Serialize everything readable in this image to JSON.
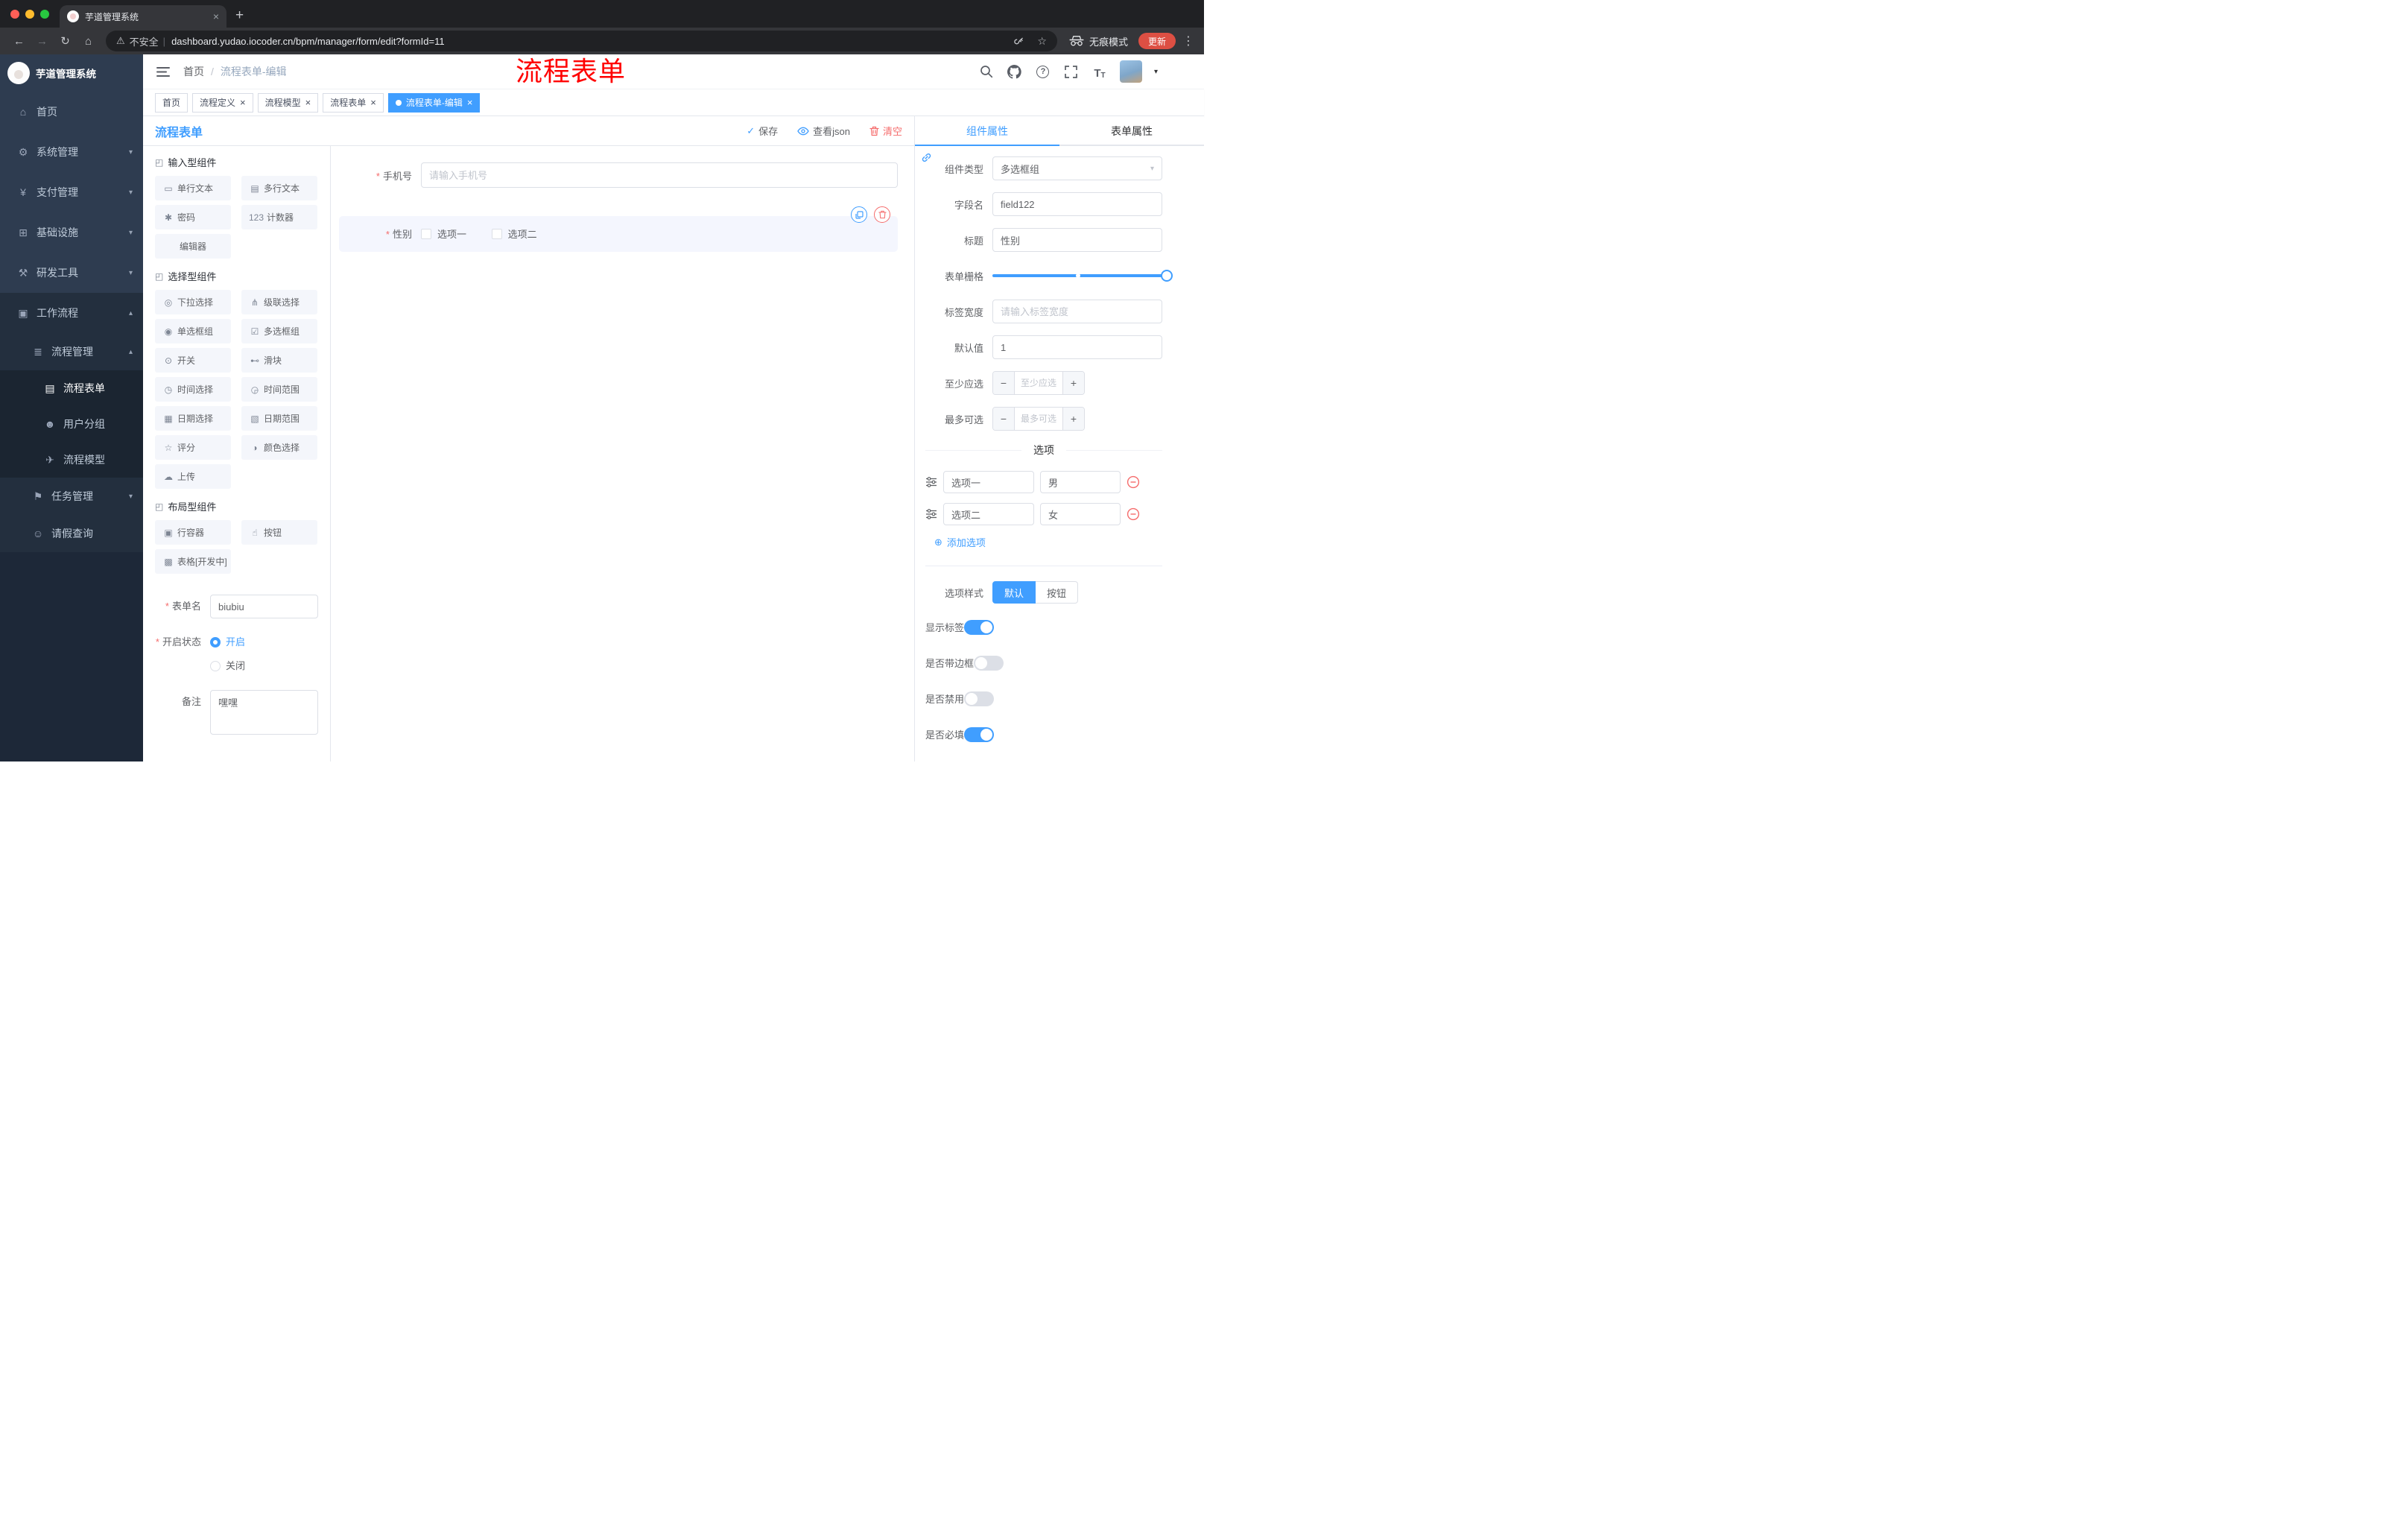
{
  "colors": {
    "accent": "#409eff",
    "danger": "#f56c6c",
    "annotation_text": "#ff0000",
    "update_button": "#dd4f43",
    "sidebar_bg": "#1d2838",
    "active_tag_bg": "#409eff"
  },
  "glyphs": {
    "back": "←",
    "forward": "→",
    "reload": "↻",
    "home": "⌂",
    "plus": "+",
    "close": "×",
    "warning": "⚠",
    "divider": "|",
    "star": "☆",
    "kebab": "⋮",
    "slash": "/",
    "check": "✓",
    "caret_down": "▾",
    "question": "?",
    "font_large": "T",
    "font_small": "T",
    "minus": "−",
    "add_circle": "⊕"
  },
  "browser": {
    "tab_title": "芋道管理系统",
    "security_label": "不安全",
    "url": "dashboard.yudao.iocoder.cn/bpm/manager/form/edit?formId=11",
    "incognito_label": "无痕模式",
    "update_label": "更新"
  },
  "sidebar": {
    "logo_title": "芋道管理系统",
    "items": [
      {
        "label": "首页",
        "glyph": "⌂",
        "icon_name": "dashboard-icon",
        "chevron": ""
      },
      {
        "label": "系统管理",
        "glyph": "⚙",
        "icon_name": "gear-icon",
        "chevron": "▾"
      },
      {
        "label": "支付管理",
        "glyph": "¥",
        "icon_name": "payment-icon",
        "chevron": "▾"
      },
      {
        "label": "基础设施",
        "glyph": "⊞",
        "icon_name": "infrastructure-icon",
        "chevron": "▾"
      },
      {
        "label": "研发工具",
        "glyph": "⚒",
        "icon_name": "devtools-icon",
        "chevron": "▾"
      },
      {
        "label": "工作流程",
        "glyph": "▣",
        "icon_name": "workflow-icon",
        "chevron": "▴",
        "open": true
      },
      {
        "label": "流程管理",
        "glyph": "≣",
        "icon_name": "process-manage-icon",
        "chevron": "▴",
        "sub": true
      },
      {
        "label": "流程表单",
        "glyph": "▤",
        "icon_name": "process-form-icon",
        "chevron": "",
        "sub2": true,
        "active": true
      },
      {
        "label": "用户分组",
        "glyph": "☻",
        "icon_name": "user-group-icon",
        "chevron": "",
        "sub2": true
      },
      {
        "label": "流程模型",
        "glyph": "✈",
        "icon_name": "process-model-icon",
        "chevron": "",
        "sub2": true
      },
      {
        "label": "任务管理",
        "glyph": "⚑",
        "icon_name": "task-manage-icon",
        "chevron": "▾",
        "sub": true
      },
      {
        "label": "请假查询",
        "glyph": "☺",
        "icon_name": "leave-query-icon",
        "chevron": "",
        "sub": true
      }
    ]
  },
  "header": {
    "breadcrumb": [
      "首页",
      "流程表单-编辑"
    ],
    "annotation": "流程表单"
  },
  "tags": [
    {
      "label": "首页",
      "closable": false,
      "active": false,
      "dot": false
    },
    {
      "label": "流程定义",
      "closable": true,
      "active": false,
      "dot": false
    },
    {
      "label": "流程模型",
      "closable": true,
      "active": false,
      "dot": false
    },
    {
      "label": "流程表单",
      "closable": true,
      "active": false,
      "dot": false
    },
    {
      "label": "流程表单-编辑",
      "closable": true,
      "active": true,
      "dot": true
    }
  ],
  "toolbar": {
    "title": "流程表单",
    "save": "保存",
    "view_json": "查看json",
    "clear": "清空"
  },
  "palette": {
    "input": {
      "title": "输入型组件",
      "icon": "◰",
      "items": [
        {
          "label": "单行文本",
          "glyph": "▭",
          "icon_name": "single-line-text-icon"
        },
        {
          "label": "多行文本",
          "glyph": "▤",
          "icon_name": "textarea-icon"
        },
        {
          "label": "密码",
          "glyph": "✱",
          "icon_name": "password-lock-icon"
        },
        {
          "label": "计数器",
          "glyph": "123",
          "icon_name": "counter-icon"
        },
        {
          "label": "编辑器",
          "glyph": "",
          "icon_name": "editor-icon",
          "no_icon": true
        }
      ]
    },
    "select": {
      "title": "选择型组件",
      "icon": "◰",
      "items": [
        {
          "label": "下拉选择",
          "glyph": "◎",
          "icon_name": "select-dropdown-icon"
        },
        {
          "label": "级联选择",
          "glyph": "⋔",
          "icon_name": "cascader-icon"
        },
        {
          "label": "单选框组",
          "glyph": "◉",
          "icon_name": "radio-group-icon"
        },
        {
          "label": "多选框组",
          "glyph": "☑",
          "icon_name": "checkbox-group-icon"
        },
        {
          "label": "开关",
          "glyph": "⊙",
          "icon_name": "switch-icon"
        },
        {
          "label": "滑块",
          "glyph": "⊷",
          "icon_name": "slider-icon"
        },
        {
          "label": "时间选择",
          "glyph": "◷",
          "icon_name": "time-picker-icon"
        },
        {
          "label": "时间范围",
          "glyph": "◶",
          "icon_name": "time-range-icon"
        },
        {
          "label": "日期选择",
          "glyph": "▦",
          "icon_name": "date-picker-icon"
        },
        {
          "label": "日期范围",
          "glyph": "▧",
          "icon_name": "date-range-icon"
        },
        {
          "label": "评分",
          "glyph": "☆",
          "icon_name": "rate-icon"
        },
        {
          "label": "颜色选择",
          "glyph": "◑",
          "icon_name": "color-picker-icon"
        },
        {
          "label": "上传",
          "glyph": "☁",
          "icon_name": "upload-icon"
        }
      ]
    },
    "layout": {
      "title": "布局型组件",
      "icon": "◰",
      "items": [
        {
          "label": "行容器",
          "glyph": "▣",
          "icon_name": "row-container-icon"
        },
        {
          "label": "按钮",
          "glyph": "☝",
          "icon_name": "button-component-icon"
        },
        {
          "label": "表格[开发中]",
          "glyph": "▩",
          "icon_name": "table-component-icon"
        }
      ]
    }
  },
  "form": {
    "name_label": "表单名",
    "name_value": "biubiu",
    "status_label": "开启状态",
    "status_on": "开启",
    "status_off": "关闭",
    "remark_label": "备注",
    "remark_value": "嘿嘿"
  },
  "canvas": {
    "phone": {
      "label": "手机号",
      "placeholder": "请输入手机号"
    },
    "gender": {
      "label": "性别",
      "options": [
        {
          "label": "选项一"
        },
        {
          "label": "选项二"
        }
      ]
    }
  },
  "panel": {
    "tabs": {
      "component": "组件属性",
      "form": "表单属性"
    },
    "rows": {
      "type_label": "组件类型",
      "type_value": "多选框组",
      "field_label": "字段名",
      "field_value": "field122",
      "title_label": "标题",
      "title_value": "性别",
      "grid_label": "表单栅格",
      "label_width_label": "标签宽度",
      "label_width_placeholder": "请输入标签宽度",
      "default_label": "默认值",
      "default_value": "1",
      "min_label": "至少应选",
      "min_placeholder": "至少应选",
      "max_label": "最多可选",
      "max_placeholder": "最多可选"
    },
    "options": {
      "title": "选项",
      "rows": [
        {
          "label": "选项一",
          "value": "男"
        },
        {
          "label": "选项二",
          "value": "女"
        }
      ],
      "add": "添加选项"
    },
    "style_row": {
      "label": "选项样式",
      "default_option": "默认",
      "button_option": "按钮"
    },
    "switches": [
      {
        "label": "显示标签",
        "on": true
      },
      {
        "label": "是否带边框",
        "on": false
      },
      {
        "label": "是否禁用",
        "on": false
      },
      {
        "label": "是否必填",
        "on": true
      }
    ]
  }
}
